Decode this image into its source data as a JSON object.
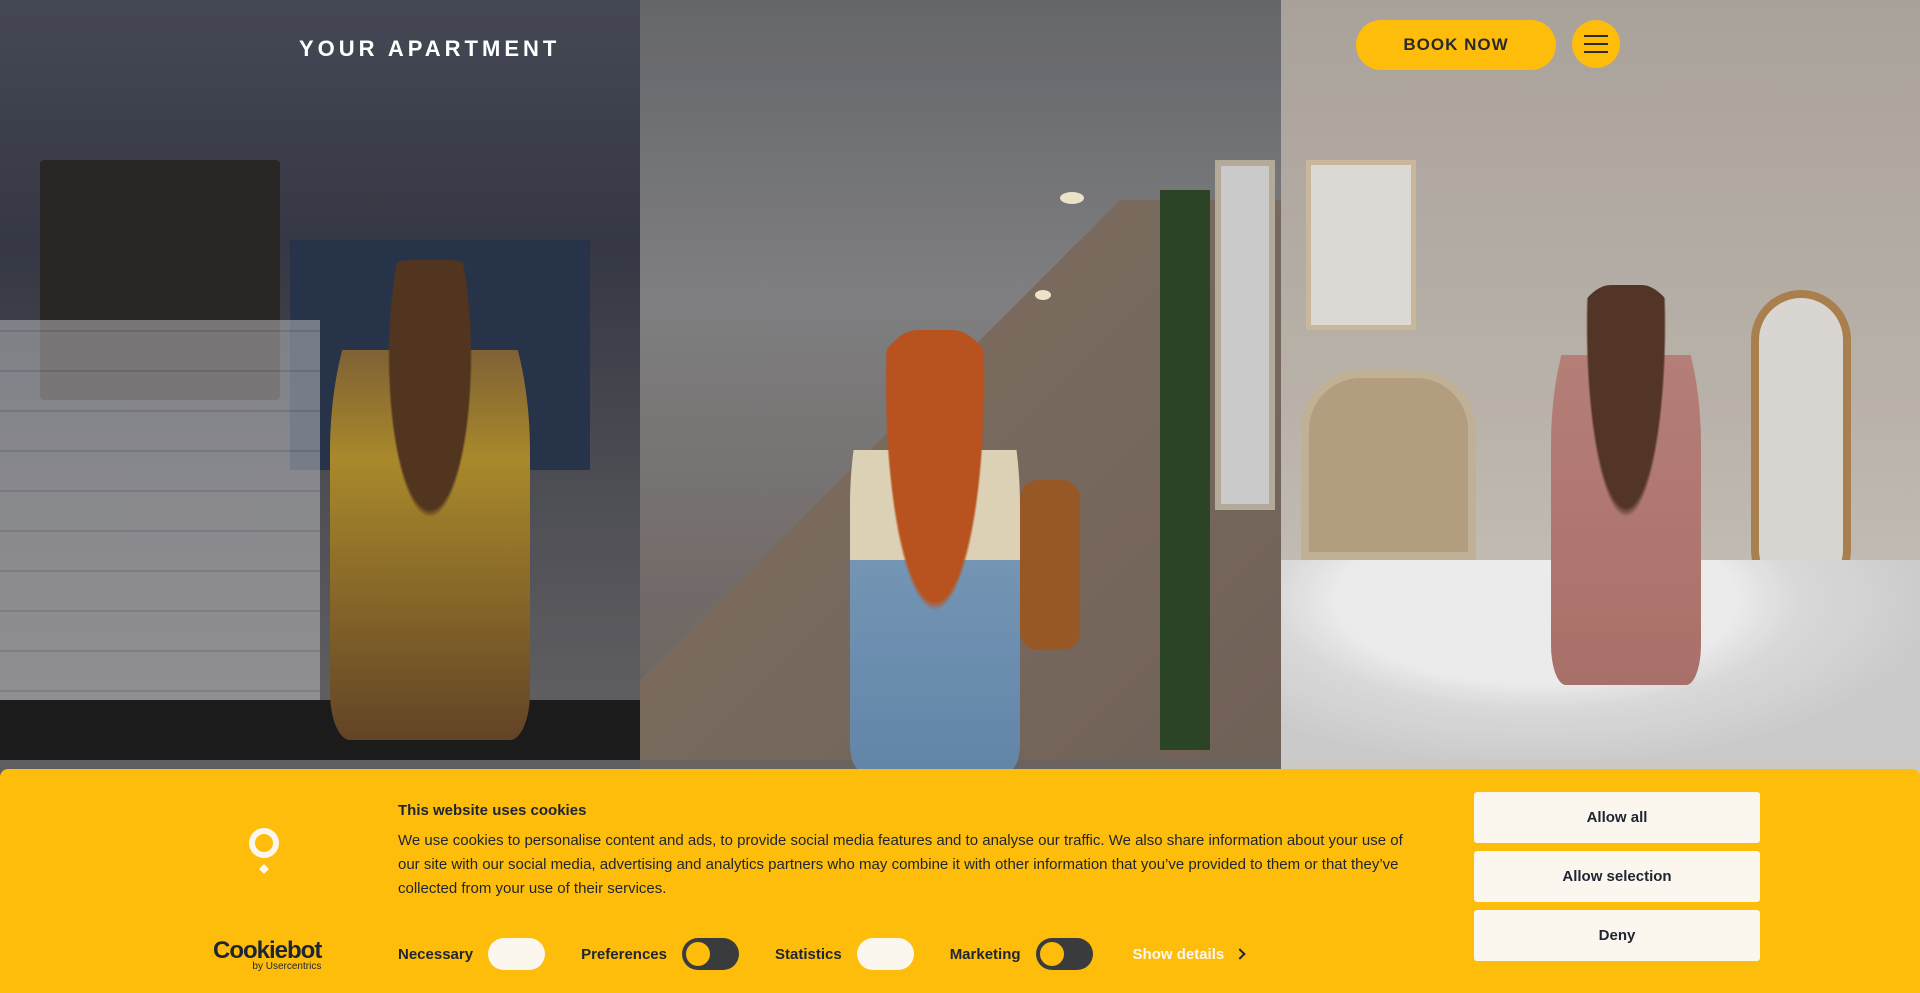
{
  "header": {
    "logo_text": "YOUR APARTMENT",
    "book_label": "BOOK NOW",
    "menu_icon": "hamburger-menu-icon",
    "accent_color": "#fdbd0a"
  },
  "cookie_banner": {
    "title": "This website uses cookies",
    "body": "We use cookies to personalise content and ads, to provide social media features and to analyse our traffic. We also share information about your use of our site with our social media, advertising and analytics partners who may combine it with other information that you’ve provided to them or that they’ve collected from your use of their services.",
    "brand_name": "Cookiebot",
    "brand_sub": "by Usercentrics",
    "toggles": [
      {
        "label": "Necessary",
        "state": "on"
      },
      {
        "label": "Preferences",
        "state": "off"
      },
      {
        "label": "Statistics",
        "state": "on"
      },
      {
        "label": "Marketing",
        "state": "off"
      }
    ],
    "show_details_label": "Show details",
    "buttons": {
      "allow_all": "Allow all",
      "allow_selection": "Allow selection",
      "deny": "Deny"
    },
    "background_color": "#fdbd0a"
  }
}
